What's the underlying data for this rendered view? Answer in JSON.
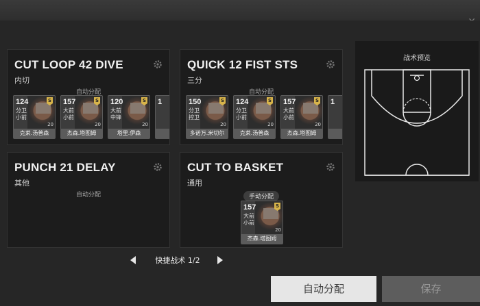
{
  "window": {
    "close_icon": "close-icon"
  },
  "tactics": [
    {
      "title": "CUT LOOP 42 DIVE",
      "subtitle": "内切",
      "assign_label": "自动分配",
      "players": [
        {
          "rating": "124",
          "pos": "分卫\n小前",
          "level": "20",
          "name": "克莱.汤普森"
        },
        {
          "rating": "157",
          "pos": "大前\n小前",
          "level": "20",
          "name": "杰森.塔图姆"
        },
        {
          "rating": "120",
          "pos": "大前\n中锋",
          "level": "20",
          "name": "塔里.伊森"
        },
        {
          "rating": "1",
          "pos": "",
          "level": "",
          "name": ""
        }
      ]
    },
    {
      "title": "QUICK 12 FIST STS",
      "subtitle": "三分",
      "assign_label": "自动分配",
      "players": [
        {
          "rating": "150",
          "pos": "分卫\n控卫",
          "level": "20",
          "name": "多诺万.米切尔"
        },
        {
          "rating": "124",
          "pos": "分卫\n小前",
          "level": "20",
          "name": "克莱.汤普森"
        },
        {
          "rating": "157",
          "pos": "大前\n小前",
          "level": "20",
          "name": "杰森.塔图姆"
        },
        {
          "rating": "1",
          "pos": "",
          "level": "",
          "name": ""
        }
      ]
    },
    {
      "title": "PUNCH 21 DELAY",
      "subtitle": "其他",
      "assign_label": "自动分配",
      "players": []
    },
    {
      "title": "CUT TO BASKET",
      "subtitle": "通用",
      "assign_label": "手动分配",
      "players": [
        {
          "rating": "157",
          "pos": "大前\n小前",
          "level": "20",
          "name": "杰森.塔图姆"
        }
      ]
    }
  ],
  "pager": {
    "label": "快捷战术 1/2"
  },
  "preview": {
    "title": "战术预览"
  },
  "buttons": {
    "auto": "自动分配",
    "save": "保存"
  }
}
